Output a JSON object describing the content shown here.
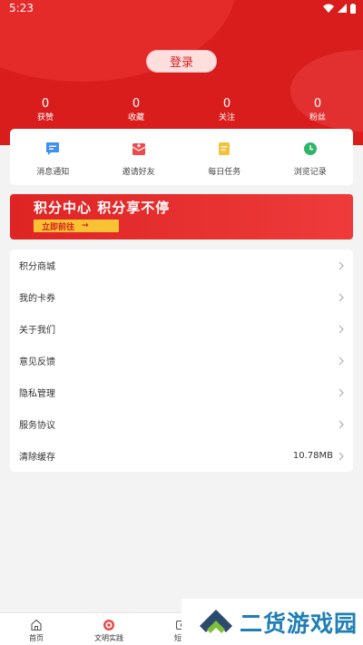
{
  "status_bar": {
    "time": "5:23"
  },
  "login": {
    "label": "登录"
  },
  "stats": [
    {
      "value": "0",
      "label": "获赞"
    },
    {
      "value": "0",
      "label": "收藏"
    },
    {
      "value": "0",
      "label": "关注"
    },
    {
      "value": "0",
      "label": "粉丝"
    }
  ],
  "quick_actions": [
    {
      "label": "消息通知",
      "icon": "message-icon",
      "color": "#3d8ff0"
    },
    {
      "label": "邀请好友",
      "icon": "invite-envelope-icon",
      "color": "#ef4a4a"
    },
    {
      "label": "每日任务",
      "icon": "task-list-icon",
      "color": "#f5c03a"
    },
    {
      "label": "浏览记录",
      "icon": "clock-icon",
      "color": "#2fb567"
    }
  ],
  "banner": {
    "title": "积分中心 积分享不停",
    "button": "立即前往",
    "button_arrow": "→"
  },
  "menu": [
    {
      "label": "积分商城"
    },
    {
      "label": "我的卡券"
    },
    {
      "label": "关于我们"
    },
    {
      "label": "意见反馈"
    },
    {
      "label": "隐私管理"
    },
    {
      "label": "服务协议"
    },
    {
      "label": "清除缓存",
      "value": "10.78MB"
    }
  ],
  "tabbar": [
    {
      "label": "首页",
      "icon": "home-icon"
    },
    {
      "label": "文明实践",
      "icon": "civilization-practice-icon"
    },
    {
      "label": "短视",
      "icon": "video-icon"
    }
  ],
  "watermark": {
    "text": "二货游戏园"
  },
  "colors": {
    "brand_red": "#d91d1d",
    "banner_button": "#f7c233",
    "watermark_blue": "#1e7fb5"
  }
}
